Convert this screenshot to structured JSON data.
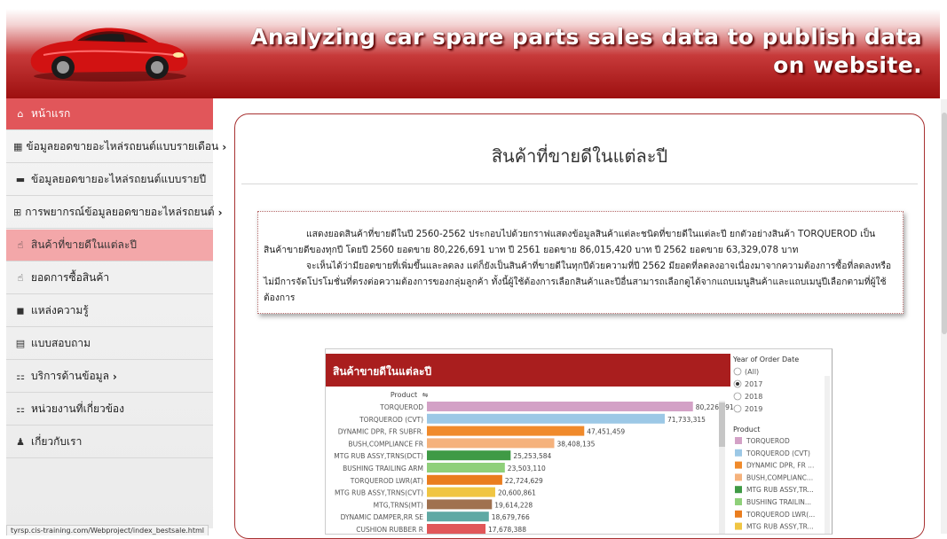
{
  "header": {
    "title": "Analyzing car spare parts sales data to publish data on website."
  },
  "nav": [
    {
      "label": "หน้าแรก",
      "icon": "home-icon",
      "glyph": "⌂",
      "state": "active",
      "chevron": false
    },
    {
      "label": "ข้อมูลยอดขายอะไหล่รถยนต์แบบรายเดือน",
      "icon": "calendar-icon",
      "glyph": "▦",
      "state": "",
      "chevron": true
    },
    {
      "label": "ข้อมูลยอดขายอะไหล่รถยนต์แบบรายปี",
      "icon": "calendar-icon",
      "glyph": "▬",
      "state": "",
      "chevron": false
    },
    {
      "label": "การพยากรณ์ข้อมูลยอดขายอะไหล่รถยนต์",
      "icon": "sitemap-icon",
      "glyph": "⊞",
      "state": "",
      "chevron": true
    },
    {
      "label": "สินค้าที่ขายดีในแต่ละปี",
      "icon": "thumbs-up-icon",
      "glyph": "☝",
      "state": "selected",
      "chevron": false
    },
    {
      "label": "ยอดการซื้อสินค้า",
      "icon": "thumbs-up-icon",
      "glyph": "☝",
      "state": "",
      "chevron": false
    },
    {
      "label": "แหล่งความรู้",
      "icon": "book-icon",
      "glyph": "◼",
      "state": "",
      "chevron": false
    },
    {
      "label": "แบบสอบถาม",
      "icon": "file-icon",
      "glyph": "▤",
      "state": "",
      "chevron": false
    },
    {
      "label": "บริการด้านข้อมูล",
      "icon": "sitemap-icon",
      "glyph": "⚏",
      "state": "",
      "chevron": true
    },
    {
      "label": "หน่วยงานที่เกี่ยวข้อง",
      "icon": "sitemap-icon",
      "glyph": "⚏",
      "state": "",
      "chevron": false
    },
    {
      "label": "เกี่ยวกับเรา",
      "icon": "user-icon",
      "glyph": "♟",
      "state": "",
      "chevron": false
    }
  ],
  "status_url": "tyrsp.cis-training.com/Webproject/index_bestsale.html",
  "page": {
    "title": "สินค้าที่ขายดีในแต่ละปี",
    "paragraph1": "แสดงยอดสินค้าที่ขายดีในปี 2560-2562 ประกอบไปด้วยกราฟแสดงข้อมูลสินค้าแต่ละชนิดที่ขายดีในแต่ละปี ยกตัวอย่างสินค้า TORQUEROD เป็นสินค้าขายดีของทุกปี โดยปี 2560 ยอดขาย 80,226,691 บาท ปี 2561 ยอดขาย 86,015,420 บาท ปี 2562 ยอดขาย 63,329,078 บาท",
    "paragraph2": "จะเห็นได้ว่ามียอดขายที่เพิ่มขึ้นและลดลง แต่ก็ยังเป็นสินค้าที่ขายดีในทุกปีด้วยความที่ปี 2562 มียอดที่ลดลงอาจเนื่องมาจากความต้องการซื้อที่ลดลงหรือไม่มีการจัดโปรโมชั่นที่ตรงต่อความต้องการของกลุ่มลูกค้า ทั้งนี้ผู้ใช้ต้องการเลือกสินค้าและปีอื่นสามารถเลือกดูได้จากแถบเมนูสินค้าและแถบเมนูปีเลือกตามที่ผู้ใช้ต้องการ"
  },
  "chart_data": {
    "type": "bar",
    "title": "สินค้าขายดีในแต่ละปี",
    "ylabel": "Product",
    "categories": [
      "TORQUEROD",
      "TORQUEROD (CVT)",
      "DYNAMIC DPR, FR SUBFR.",
      "BUSH,COMPLIANCE FR",
      "MTG RUB ASSY,TRNS(DCT)",
      "BUSHING TRAILING ARM",
      "TORQUEROD LWR(AT)",
      "MTG RUB ASSY,TRNS(CVT)",
      "MTG,TRNS(MT)",
      "DYNAMIC DAMPER,RR SE",
      "CUSHION RUBBER R"
    ],
    "values": [
      80226691,
      71733315,
      47451459,
      38408135,
      25253584,
      23503110,
      22724629,
      20600861,
      19614228,
      18679766,
      17678388
    ],
    "value_labels": [
      "80,226,691",
      "71,733,315",
      "47,451,459",
      "38,408,135",
      "25,253,584",
      "23,503,110",
      "22,724,629",
      "20,600,861",
      "19,614,228",
      "18,679,766",
      "17,678,388"
    ],
    "colors": [
      "#d3a1c6",
      "#9cc8e6",
      "#f08a2b",
      "#f5b27c",
      "#3f9a45",
      "#8fd07a",
      "#ea7d1e",
      "#f0c542",
      "#a0714f",
      "#5fa9a4",
      "#e15759"
    ],
    "year_filter": {
      "title": "Year of Order Date",
      "options": [
        "(All)",
        "2017",
        "2018",
        "2019"
      ],
      "selected": "2017"
    },
    "legend": {
      "title": "Product",
      "items": [
        "TORQUEROD",
        "TORQUEROD (CVT)",
        "DYNAMIC DPR, FR ...",
        "BUSH,COMPLIANC...",
        "MTG RUB ASSY,TR...",
        "BUSHING TRAILIN...",
        "TORQUEROD LWR(...",
        "MTG RUB ASSY,TR..."
      ]
    },
    "colors_note_theme": "#a91e1e"
  }
}
